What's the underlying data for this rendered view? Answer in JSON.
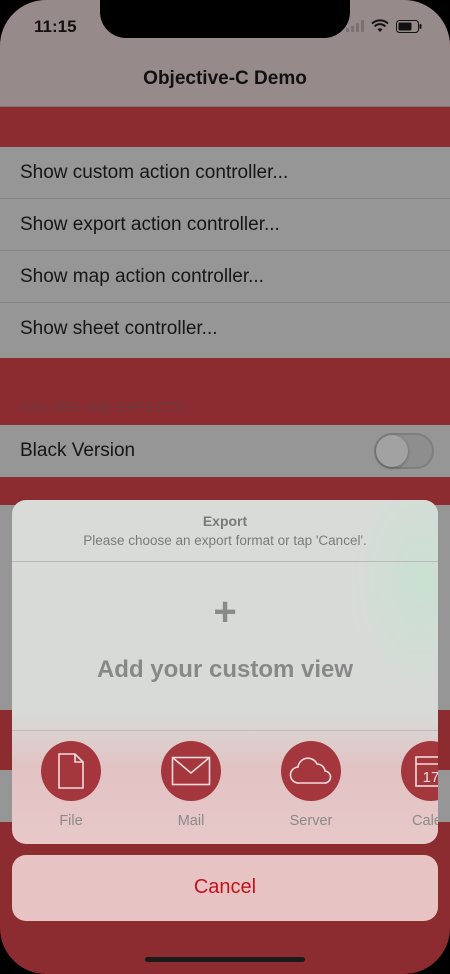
{
  "status_bar": {
    "time": "11:15"
  },
  "nav": {
    "title": "Objective-C Demo"
  },
  "menu": {
    "items": [
      {
        "label": "Show custom action controller..."
      },
      {
        "label": "Show export action controller..."
      },
      {
        "label": "Show map action controller..."
      },
      {
        "label": "Show sheet controller..."
      }
    ]
  },
  "colors_section": {
    "header": "COLORS AND EFFECTS",
    "black_version_label": "Black Version",
    "black_version_on": false
  },
  "sheet": {
    "title": "Export",
    "message": "Please choose an export format or tap 'Cancel'.",
    "custom_plus": "+",
    "custom_label": "Add your custom view",
    "actions": [
      {
        "label": "File",
        "icon": "file-icon"
      },
      {
        "label": "Mail",
        "icon": "mail-icon"
      },
      {
        "label": "Server",
        "icon": "cloud-icon"
      },
      {
        "label": "Calen",
        "icon": "calendar-icon",
        "icon_text": "17"
      }
    ],
    "cancel_label": "Cancel"
  },
  "colors": {
    "accent_red": "#8c2c31",
    "cancel_text": "#c3121c"
  }
}
